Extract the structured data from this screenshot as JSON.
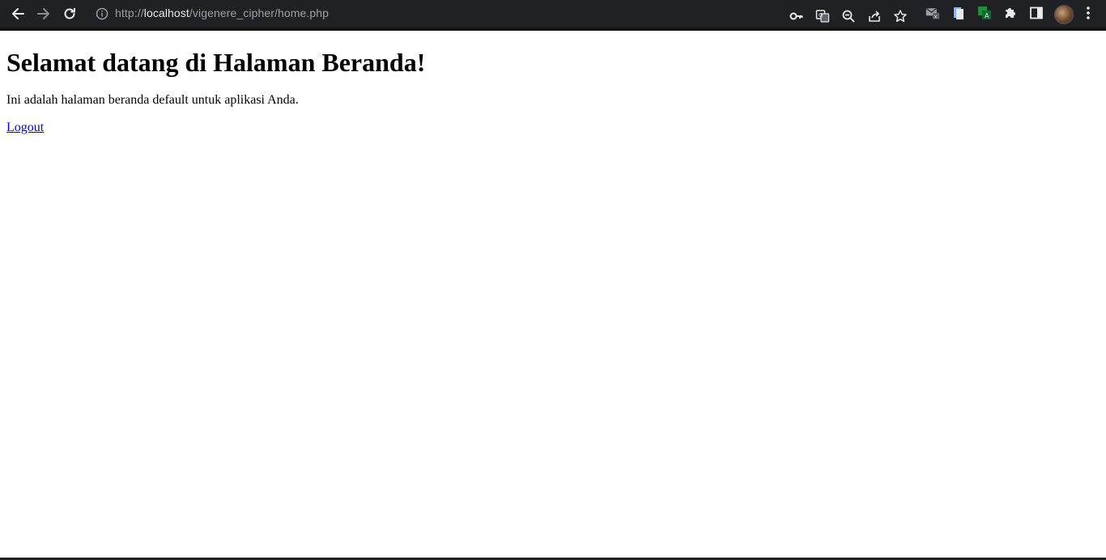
{
  "browser": {
    "url_scheme": "http://",
    "url_host": "localhost",
    "url_path": "/vigenere_cipher/home.php",
    "nav": {
      "back_icon": "back-arrow-icon",
      "forward_icon": "forward-arrow-icon",
      "reload_icon": "reload-icon"
    },
    "toolbar_icons": [
      "key-icon",
      "translate-icon",
      "zoom-out-icon",
      "share-icon",
      "star-icon"
    ],
    "extensions": [
      "mail-extension-icon",
      "document-extension-icon",
      "translate-extension-icon",
      "puzzle-icon",
      "side-panel-icon"
    ],
    "theme": {
      "toolbar_bg": "#202124",
      "icon_color": "#e8eaed",
      "muted_text": "#9aa0a6"
    }
  },
  "page": {
    "heading": "Selamat datang di Halaman Beranda!",
    "description": "Ini adalah halaman beranda default untuk aplikasi Anda.",
    "logout_link": "Logout",
    "link_color": "#0000ee"
  }
}
